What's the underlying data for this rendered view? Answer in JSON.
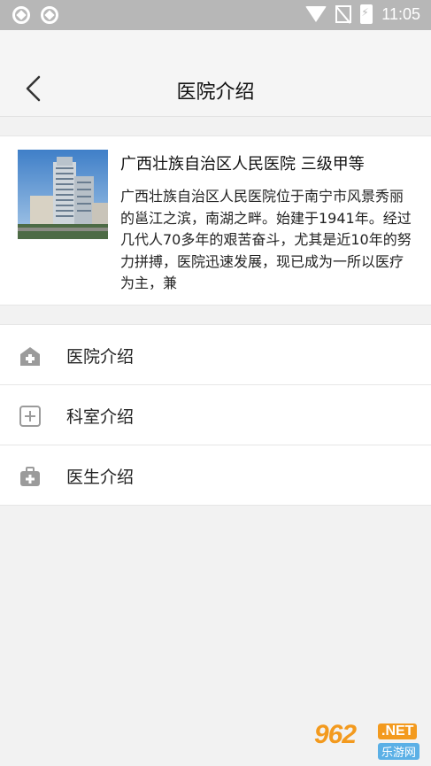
{
  "status_bar": {
    "time": "11:05"
  },
  "header": {
    "title": "医院介绍"
  },
  "intro": {
    "hospital_name": "广西壮族自治区人民医院 三级甲等",
    "description": "广西壮族自治区人民医院位于南宁市风景秀丽的邕江之滨，南湖之畔。始建于1941年。经过几代人70多年的艰苦奋斗，尤其是近10年的努力拼搏，医院迅速发展，现已成为一所以医疗为主，兼"
  },
  "menu": {
    "items": [
      {
        "label": "医院介绍",
        "icon": "hospital-icon"
      },
      {
        "label": "科室介绍",
        "icon": "plus-box-icon"
      },
      {
        "label": "医生介绍",
        "icon": "medical-kit-icon"
      }
    ]
  },
  "watermark": {
    "number": "962",
    "domain": ".NET",
    "sub": "乐游网"
  }
}
